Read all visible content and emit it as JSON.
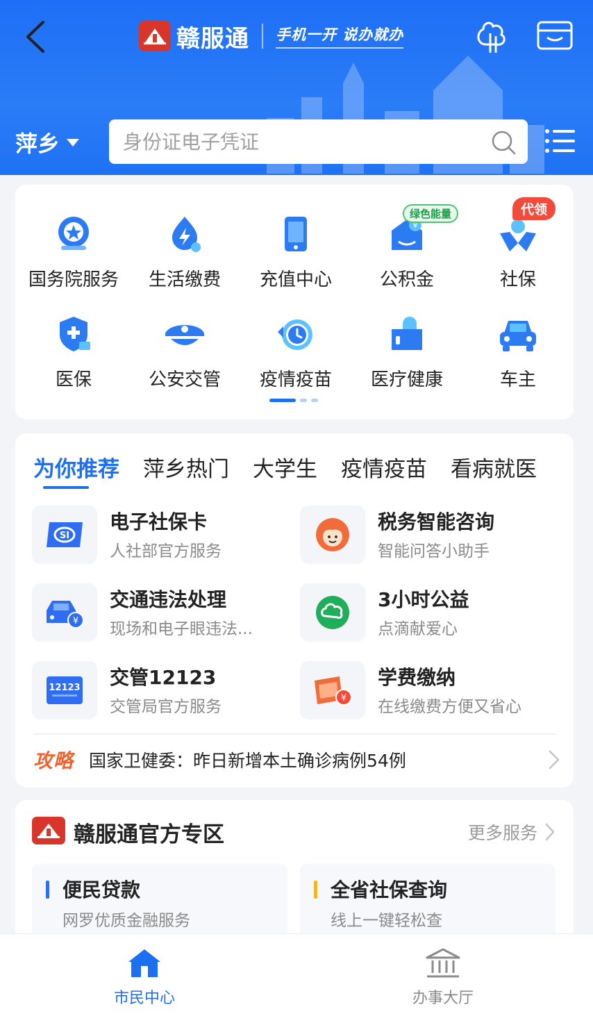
{
  "header": {
    "brand_name": "赣服通",
    "slogan": "手机一开 说办就办",
    "city": "萍乡",
    "search_placeholder": "身份证电子凭证"
  },
  "services": {
    "items": [
      {
        "label": "国务院服务",
        "icon": "state-council-icon"
      },
      {
        "label": "生活缴费",
        "icon": "utility-payment-icon"
      },
      {
        "label": "充值中心",
        "icon": "recharge-icon"
      },
      {
        "label": "公积金",
        "icon": "housing-fund-icon",
        "badge": "绿色能量"
      },
      {
        "label": "社保",
        "icon": "social-security-icon",
        "badge": "代领"
      },
      {
        "label": "医保",
        "icon": "medical-insurance-icon"
      },
      {
        "label": "公安交管",
        "icon": "police-traffic-icon"
      },
      {
        "label": "疫情疫苗",
        "icon": "vaccine-icon"
      },
      {
        "label": "医疗健康",
        "icon": "healthcare-icon"
      },
      {
        "label": "车主",
        "icon": "car-owner-icon"
      }
    ]
  },
  "recommend": {
    "tabs": [
      "为你推荐",
      "萍乡热门",
      "大学生",
      "疫情疫苗",
      "看病就医"
    ],
    "active_tab": 0,
    "items": [
      {
        "title": "电子社保卡",
        "subtitle": "人社部官方服务",
        "icon": "social-card-icon"
      },
      {
        "title": "税务智能咨询",
        "subtitle": "智能问答小助手",
        "icon": "tax-assistant-icon"
      },
      {
        "title": "交通违法处理",
        "subtitle": "现场和电子眼违法...",
        "icon": "traffic-violation-icon"
      },
      {
        "title": "3小时公益",
        "subtitle": "点滴献爱心",
        "icon": "charity-icon"
      },
      {
        "title": "交管12123",
        "subtitle": "交管局官方服务",
        "icon": "traffic-12123-icon"
      },
      {
        "title": "学费缴纳",
        "subtitle": "在线缴费方便又省心",
        "icon": "tuition-icon"
      }
    ],
    "news_tag": "攻略",
    "news_text": "国家卫健委：昨日新增本土确诊病例54例"
  },
  "official_zone": {
    "title": "赣服通官方专区",
    "more": "更多服务",
    "items": [
      {
        "title": "便民贷款",
        "subtitle": "网罗优质金融服务",
        "accent": "#2f6ef2"
      },
      {
        "title": "全省社保查询",
        "subtitle": "线上一键轻松查",
        "accent": "#f5b520"
      }
    ]
  },
  "bottom_nav": {
    "items": [
      {
        "label": "市民中心",
        "active": true
      },
      {
        "label": "办事大厅",
        "active": false
      }
    ]
  },
  "colors": {
    "primary": "#1d6ff2",
    "brand_red": "#d9362b",
    "news_orange": "#f0622b"
  }
}
